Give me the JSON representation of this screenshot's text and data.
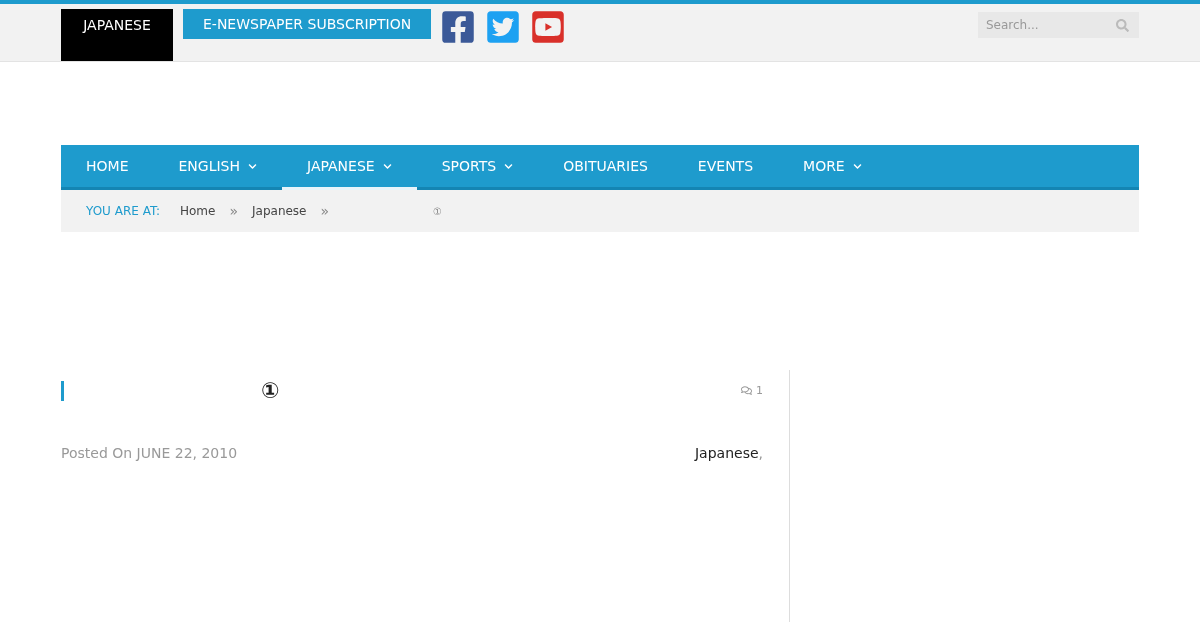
{
  "top_bar": {
    "language_label": "JAPANESE",
    "subscription_button": "E-NEWSPAPER SUBSCRIPTION",
    "search": {
      "placeholder": "Search..."
    }
  },
  "nav": [
    {
      "label": "HOME",
      "has_dropdown": false,
      "selected": false
    },
    {
      "label": "ENGLISH",
      "has_dropdown": true,
      "selected": false
    },
    {
      "label": "JAPANESE",
      "has_dropdown": true,
      "selected": true
    },
    {
      "label": "SPORTS",
      "has_dropdown": true,
      "selected": false
    },
    {
      "label": "OBITUARIES",
      "has_dropdown": false,
      "selected": false
    },
    {
      "label": "EVENTS",
      "has_dropdown": false,
      "selected": false
    },
    {
      "label": "MORE",
      "has_dropdown": true,
      "selected": false
    }
  ],
  "breadcrumb": {
    "label": "YOU ARE AT:",
    "items": [
      {
        "label": "Home",
        "separator": "»"
      },
      {
        "label": "Japanese",
        "separator": "»"
      },
      {
        "label": "①"
      }
    ]
  },
  "post": {
    "title": "①",
    "comments": "1",
    "posted_label": "Posted On",
    "date": "JUNE 22, 2010",
    "categories": [
      {
        "label": "Japanese",
        "separator": ","
      }
    ]
  }
}
